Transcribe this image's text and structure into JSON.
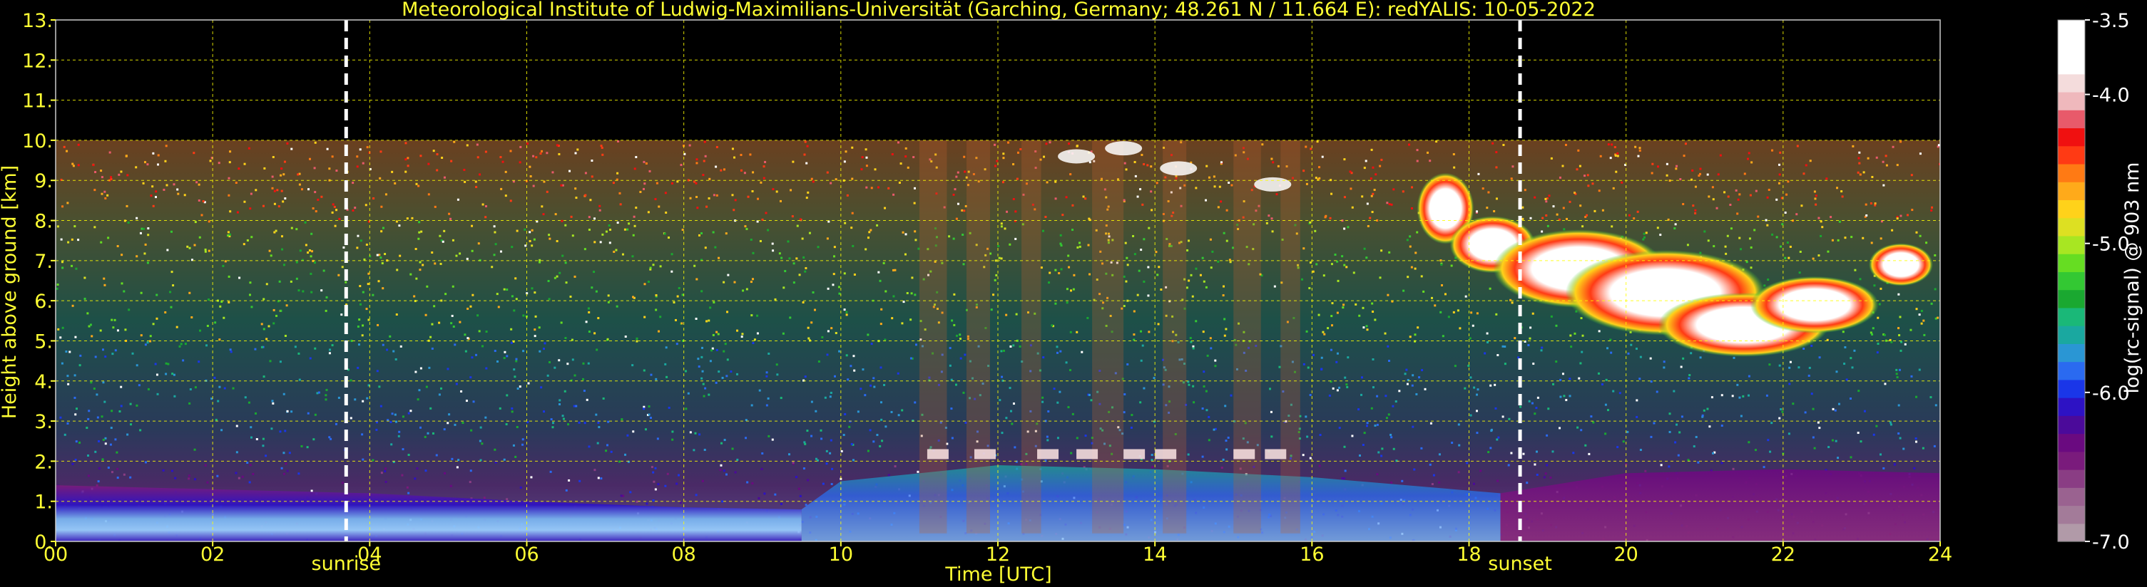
{
  "chart_data": {
    "type": "heatmap",
    "title": "Meteorological Institute of Ludwig-Maximilians-Universität (Garching, Germany; 48.261 N / 11.664 E):    redYALIS: 10-05-2022",
    "xlabel": "Time [UTC]",
    "ylabel": "Height above ground [km]",
    "xlim": [
      0,
      24
    ],
    "ylim": [
      0,
      13
    ],
    "data_ceiling_km": 10,
    "x_ticks": [
      "00",
      "02",
      "04",
      "06",
      "08",
      "10",
      "12",
      "14",
      "16",
      "18",
      "20",
      "22",
      "24"
    ],
    "x_tick_values": [
      0,
      2,
      4,
      6,
      8,
      10,
      12,
      14,
      16,
      18,
      20,
      22,
      24
    ],
    "y_ticks": [
      "0.",
      "1.",
      "2.",
      "3.",
      "4.",
      "5.",
      "6.",
      "7.",
      "8.",
      "9.",
      "10.",
      "11.",
      "12.",
      "13."
    ],
    "y_tick_values": [
      0,
      1,
      2,
      3,
      4,
      5,
      6,
      7,
      8,
      9,
      10,
      11,
      12,
      13
    ],
    "grid": true,
    "grid_color": "#ffff00",
    "markers": [
      {
        "label": "sunrise",
        "x": 3.7
      },
      {
        "label": "sunset",
        "x": 18.65
      }
    ],
    "colorbar": {
      "label": "log(rc-signal) @ 903 nm",
      "range": [
        -7.0,
        -3.5
      ],
      "ticks": [
        "-3.5",
        "-4.0",
        "-5.0",
        "-6.0",
        "-7.0"
      ],
      "tick_values": [
        -3.5,
        -4.0,
        -5.0,
        -6.0,
        -7.0
      ],
      "colors": [
        "#b19aa8",
        "#a37b99",
        "#9a6290",
        "#8a3d84",
        "#7a1b7c",
        "#6a0a80",
        "#4b0a9a",
        "#2d12c4",
        "#1a36e8",
        "#2a6af0",
        "#2a96d4",
        "#1aa8a0",
        "#1ab878",
        "#1aa830",
        "#33c833",
        "#66dd22",
        "#a8e622",
        "#dde022",
        "#ffd21a",
        "#ffaa1a",
        "#ff7a14",
        "#ff3a14",
        "#f01010",
        "#e85a6a",
        "#efb8bc",
        "#f4dcdc",
        "#ffffff",
        "#ffffff",
        "#ffffff"
      ]
    }
  }
}
